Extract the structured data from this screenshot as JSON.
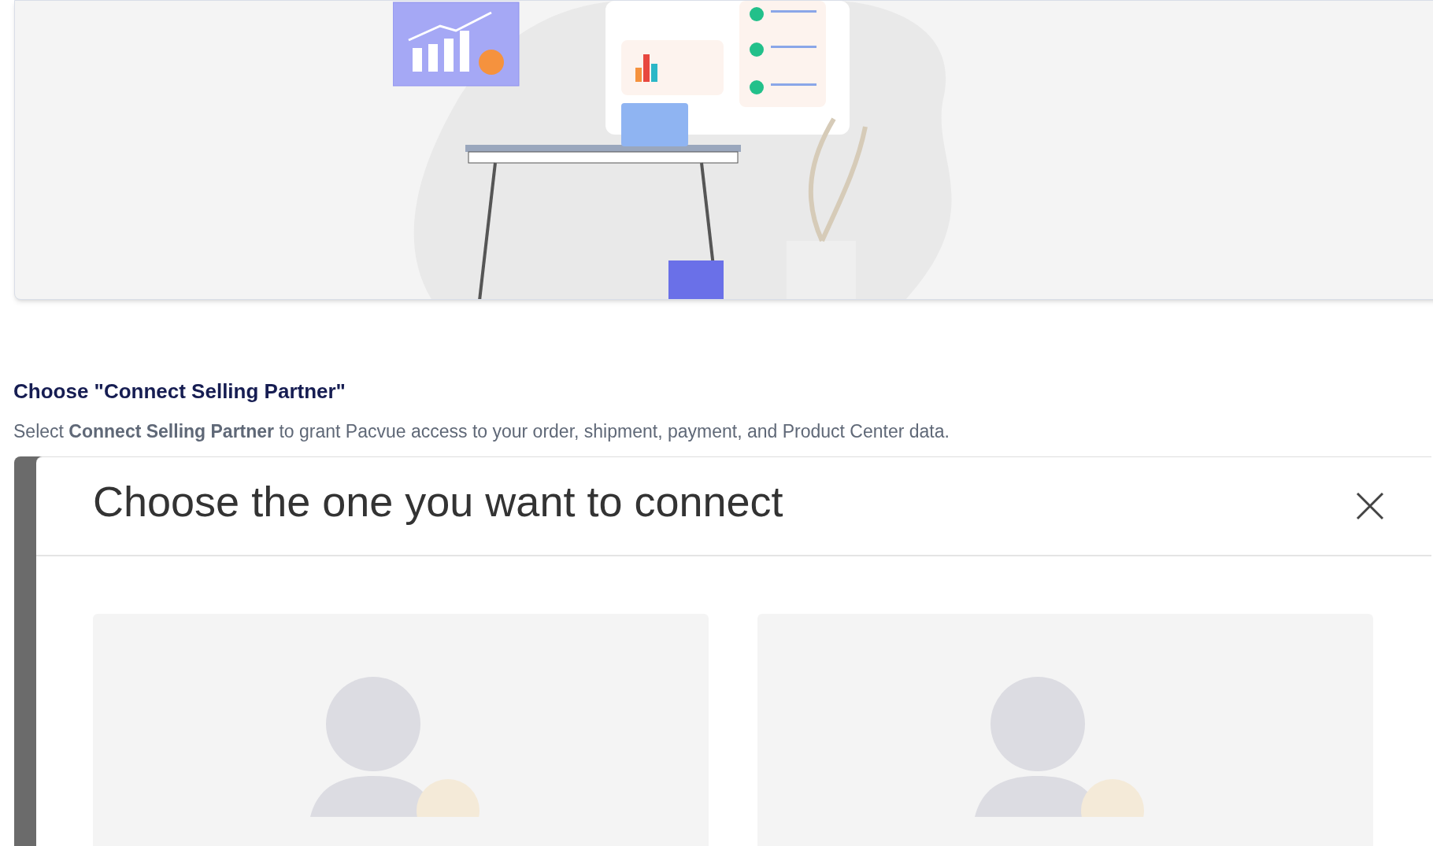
{
  "section": {
    "heading": "Choose \"Connect Selling Partner\"",
    "description": "Select **Connect Selling Partner** to grant Pacvue access to your order, shipment, payment, and Product Center data."
  },
  "dialog": {
    "title": "Choose the one you want to connect"
  }
}
